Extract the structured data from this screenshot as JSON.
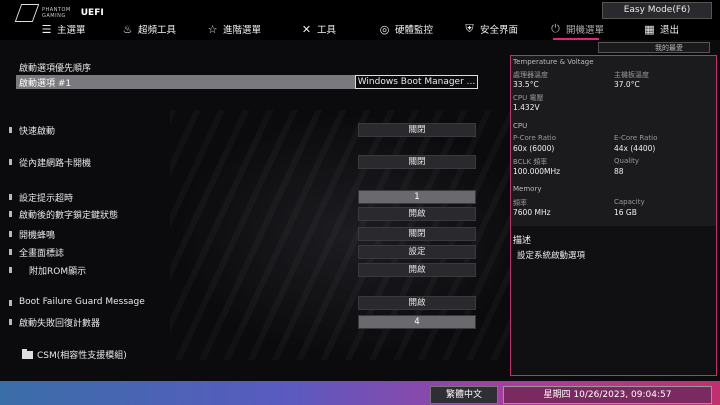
{
  "logo": {
    "brand_line1": "PHANTOM",
    "brand_line2": "GAMING",
    "product": "UEFI"
  },
  "easy_mode": "Easy Mode(F6)",
  "nav": {
    "main": "主選單",
    "oc": "超頻工具",
    "advanced": "進階選單",
    "tools": "工具",
    "hw_monitor": "硬體監控",
    "security": "安全界面",
    "boot": "開機選單",
    "exit": "退出"
  },
  "favorite": "我的最愛",
  "boot": {
    "section_title": "啟動選項優先順序",
    "option1_label": "啟動選項 #1",
    "option1_value": "Windows Boot Manager ...",
    "fast_boot": {
      "label": "快速啟動",
      "value": "關閉"
    },
    "onboard_lan": {
      "label": "從內建網路卡開機",
      "value": "關閉"
    },
    "setup_prompt": {
      "label": "設定提示超時",
      "value": "1"
    },
    "numlock": {
      "label": "啟動後的數字鎖定鍵狀態",
      "value": "開啟"
    },
    "beep": {
      "label": "開機蜂鳴",
      "value": "關閉"
    },
    "full_logo": {
      "label": "全畫面標誌",
      "value": "設定"
    },
    "addon_rom": {
      "label": "附加ROM顯示",
      "value": "開啟"
    },
    "bfgm": {
      "label": "Boot Failure Guard Message",
      "value": "開啟"
    },
    "fail_count": {
      "label": "啟動失敗回復計數器",
      "value": "4"
    },
    "csm": "CSM(相容性支援模組)"
  },
  "info": {
    "tv_head": "Temperature & Voltage",
    "cpu_temp_label": "處理器溫度",
    "cpu_temp": "33.5°C",
    "mb_temp_label": "主機板溫度",
    "mb_temp": "37.0°C",
    "vcore_label": "CPU 電壓",
    "vcore": "1.432V",
    "cpu_head": "CPU",
    "pcore_label": "P-Core Ratio",
    "pcore": "60x (6000)",
    "ecore_label": "E-Core Ratio",
    "ecore": "44x (4400)",
    "bclk_label": "BCLK 頻率",
    "bclk": "100.000MHz",
    "quality_label": "Quality",
    "quality": "88",
    "mem_head": "Memory",
    "freq_label": "頻率",
    "freq": "7600 MHz",
    "cap_label": "Capacity",
    "cap": "16 GB",
    "desc_title": "描述",
    "desc_text": "設定系統啟動選項"
  },
  "bottom": {
    "language": "繁體中文",
    "datetime": "星期四 10/26/2023, 09:04:57"
  }
}
